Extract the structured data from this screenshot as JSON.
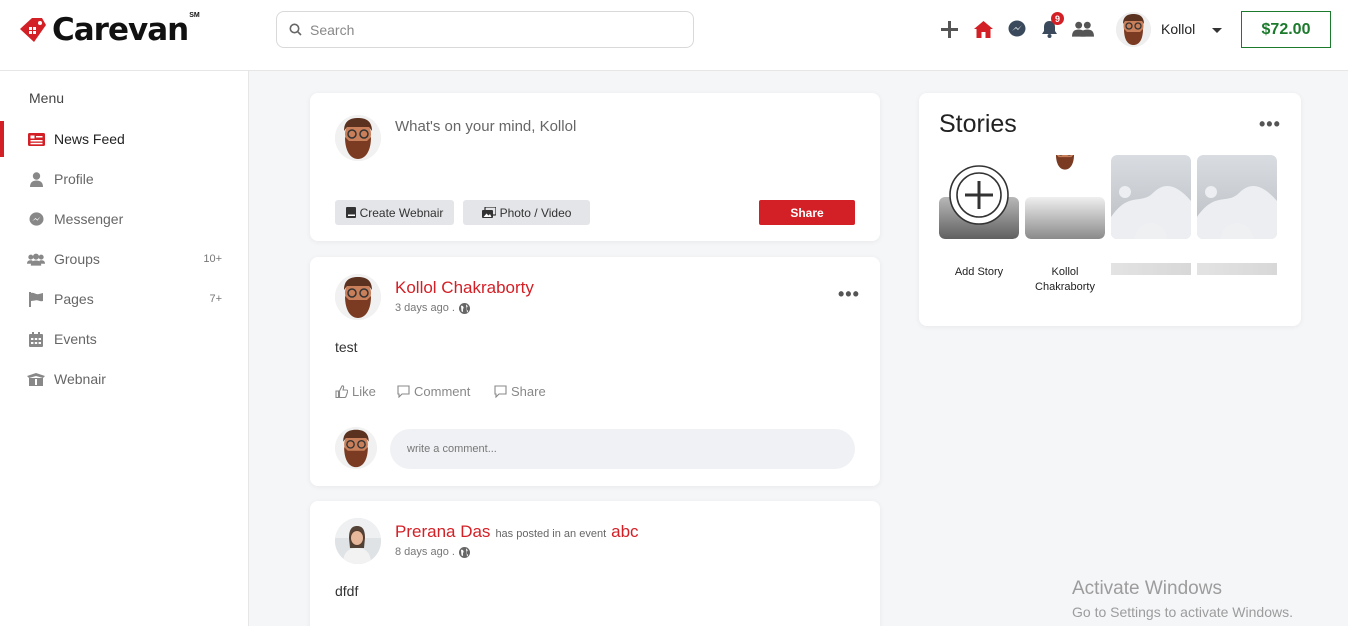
{
  "brand": {
    "name": "Carevan",
    "mark": "SM"
  },
  "search": {
    "placeholder": "Search"
  },
  "header": {
    "notification_count": "9",
    "user_name": "Kollol",
    "balance": "$72.00",
    "accent_color": "#d32026",
    "balance_color": "#1c7a2c"
  },
  "sidebar": {
    "title": "Menu",
    "items": [
      {
        "label": "News Feed",
        "icon": "newspaper-icon",
        "count": ""
      },
      {
        "label": "Profile",
        "icon": "user-icon",
        "count": ""
      },
      {
        "label": "Messenger",
        "icon": "messenger-icon",
        "count": ""
      },
      {
        "label": "Groups",
        "icon": "users-icon",
        "count": "10+"
      },
      {
        "label": "Pages",
        "icon": "flag-icon",
        "count": "7+"
      },
      {
        "label": "Events",
        "icon": "calendar-icon",
        "count": ""
      },
      {
        "label": "Webnair",
        "icon": "box-icon",
        "count": ""
      }
    ]
  },
  "composer": {
    "prompt": "What's on your mind, Kollol",
    "create_webnair": "Create Webnair",
    "photo_video": "Photo / Video",
    "share": "Share"
  },
  "posts": [
    {
      "author": "Kollol Chakraborty",
      "time": "3 days ago .",
      "text": "test",
      "actions": {
        "like": "Like",
        "comment": "Comment",
        "share": "Share"
      },
      "comment_placeholder": "write a comment..."
    },
    {
      "author": "Prerana Das",
      "context": "has posted in an event",
      "event": "abc",
      "time": "8 days ago .",
      "text": "dfdf"
    }
  ],
  "stories": {
    "title": "Stories",
    "add_label": "Add Story",
    "user_story_label": "Kollol Chakraborty"
  },
  "watermark": {
    "line1": "Activate Windows",
    "line2": "Go to Settings to activate Windows."
  }
}
